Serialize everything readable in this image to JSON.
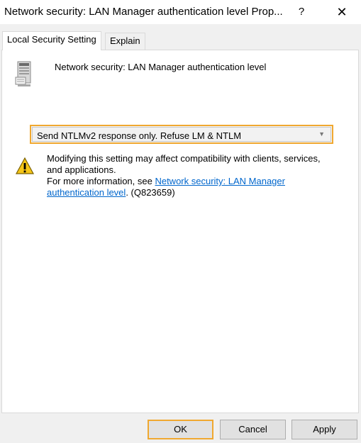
{
  "window": {
    "title": "Network security: LAN Manager authentication level Prop...",
    "help_label": "?",
    "close_label": "✕"
  },
  "tabs": [
    {
      "label": "Local Security Setting",
      "active": true
    },
    {
      "label": "Explain",
      "active": false
    }
  ],
  "policy": {
    "name": "Network security: LAN Manager authentication level",
    "icon": "server-icon"
  },
  "setting": {
    "selected": "Send NTLMv2 response only. Refuse LM & NTLM",
    "highlight_color": "#f0a830"
  },
  "warning": {
    "icon": "warning-icon",
    "line1": "Modifying this setting may affect compatibility with clients, services, and applications.",
    "more_prefix": "For more information, see ",
    "link_text": "Network security: LAN Manager authentication level",
    "suffix": ". (Q823659)",
    "link_color": "#0066cc"
  },
  "buttons": {
    "ok": "OK",
    "cancel": "Cancel",
    "apply": "Apply"
  }
}
